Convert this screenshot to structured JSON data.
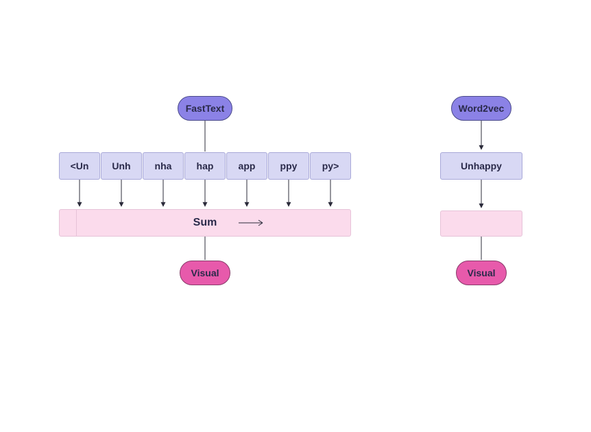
{
  "left": {
    "title": "FastText",
    "tokens": [
      "<Un",
      "Unh",
      "nha",
      "hap",
      "app",
      "ppy",
      "py>"
    ],
    "sum_label": "Sum",
    "output": "Visual"
  },
  "right": {
    "title": "Word2vec",
    "word": "Unhappy",
    "output": "Visual"
  },
  "colors": {
    "purple_fill": "#8b82e6",
    "lav_fill": "#d8d8f4",
    "pink_fill": "#fbdbec",
    "magenta_fill": "#e75aab"
  }
}
